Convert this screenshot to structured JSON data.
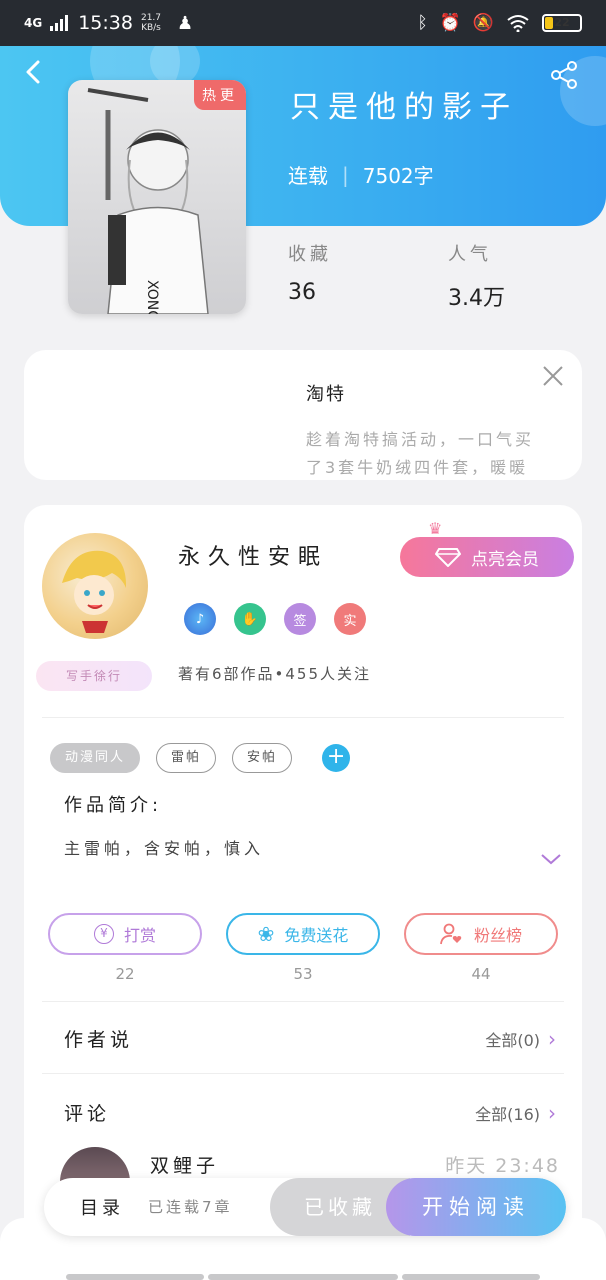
{
  "status_bar": {
    "network": "4G",
    "time": "15:38",
    "speed_value": "21.7",
    "speed_unit": "KB/s",
    "battery": "22"
  },
  "book": {
    "title": "只是他的影子",
    "status": "连载",
    "word_count": "7502字",
    "hot_tag": "热更",
    "favorites_label": "收藏",
    "favorites_value": "36",
    "popularity_label": "人气",
    "popularity_value": "3.4万"
  },
  "ad": {
    "title": "淘特",
    "line1": "趁着淘特搞活动，一口气买",
    "line2": "了3套牛奶绒四件套，暖暖"
  },
  "author": {
    "name": "永久性安眠",
    "vip_button": "点亮会员",
    "writer_badge": "写手徐行",
    "stats": "著有6部作品•455人关注",
    "badge_sign": "签",
    "badge_real": "实"
  },
  "tags": [
    "动漫同人",
    "雷帕",
    "安帕"
  ],
  "intro": {
    "label": "作品简介:",
    "text": "主雷帕，含安帕，慎入"
  },
  "actions": [
    {
      "label": "打赏",
      "count": "22",
      "color": "#b07ad8"
    },
    {
      "label": "免费送花",
      "count": "53",
      "color": "#3ab6e8"
    },
    {
      "label": "粉丝榜",
      "count": "44",
      "color": "#f07878"
    }
  ],
  "author_says": {
    "title": "作者说",
    "more": "全部(0)"
  },
  "comments": {
    "title": "评论",
    "more": "全部(16)",
    "first_name": "双鲤子",
    "first_time": "昨天 23:48"
  },
  "bottom": {
    "toc": "目录",
    "toc_sub": "已连载7章",
    "saved": "已收藏",
    "read": "开始阅读"
  },
  "colors": {
    "header_start": "#4cc6f2",
    "header_end": "#2f9cf0",
    "accent_purple": "#b07ad8",
    "accent_blue": "#3ab6e8",
    "accent_red": "#f07878"
  }
}
